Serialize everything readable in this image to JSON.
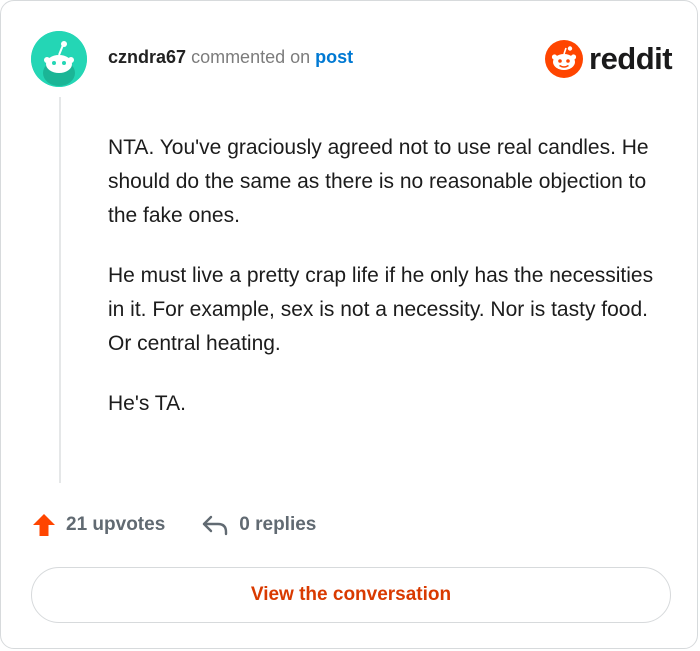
{
  "comment": {
    "username": "czndra67",
    "action_text": "commented on",
    "post_link": "post",
    "paragraphs": [
      "NTA. You've graciously agreed not to use real candles. He should do the same as there is no reasonable objection to the fake ones.",
      "He must live a pretty crap life if he only has the necessities in it. For example, sex is not a necessity. Nor is tasty food. Or central heating.",
      "He's TA."
    ]
  },
  "brand": {
    "name": "reddit",
    "logo_icon": "reddit-snoo-icon"
  },
  "footer": {
    "upvotes_label": "21 upvotes",
    "replies_label": "0 replies",
    "upvote_icon": "arrow-up-icon",
    "reply_icon": "reply-arrow-icon"
  },
  "cta": {
    "label": "View the conversation"
  },
  "colors": {
    "accent": "#d93a00",
    "reddit_orange": "#ff4500",
    "avatar_teal": "#24d6b5",
    "link_blue": "#0079d3"
  }
}
